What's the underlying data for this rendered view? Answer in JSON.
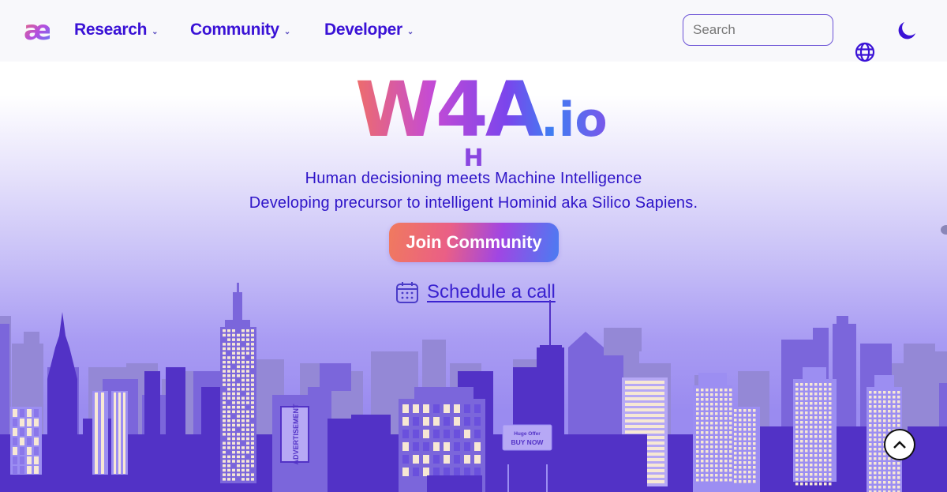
{
  "nav": {
    "logo": "æ",
    "items": [
      {
        "label": "Research",
        "chevron": "⌄"
      },
      {
        "label": "Community",
        "chevron": "⌄"
      },
      {
        "label": "Developer",
        "chevron": "⌄"
      }
    ],
    "search_placeholder": "Search",
    "theme_icon": "moon-icon",
    "language_icon": "globe-icon"
  },
  "hero": {
    "title_main": "W4A",
    "title_suffix": ".io",
    "typed_text": "H",
    "tagline_1": "Human decisioning meets Machine Intelligence",
    "tagline_2": "Developing precursor to intelligent Hominid aka Silico Sapiens.",
    "join_button": "Join Community",
    "schedule_link": "Schedule a call"
  },
  "cityscape": {
    "ad_sign": "ADVERTISEMENT",
    "billboard_line1": "Huge Offer",
    "billboard_line2": "BUY NOW"
  },
  "colors": {
    "brand": "#3a12d6",
    "building_front": "#5232c6",
    "building_mid": "#7b66db",
    "building_back": "#9488d6",
    "window": "#f7e8d4"
  }
}
